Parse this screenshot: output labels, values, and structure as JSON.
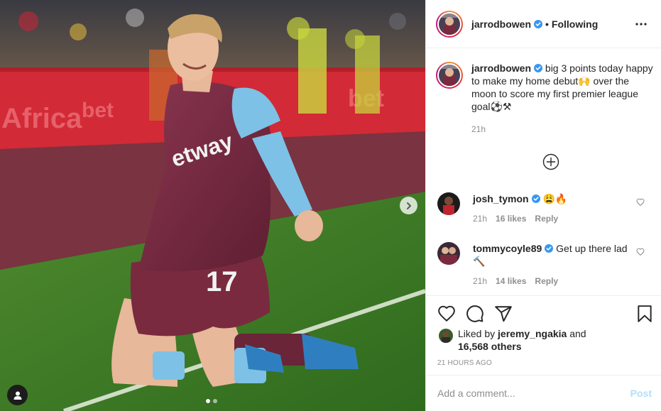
{
  "photo": {
    "jersey_number": "17",
    "sponsor_text": "Betway",
    "slide_count": 2,
    "active_slide": 1
  },
  "header": {
    "username": "jarrodbowen",
    "separator": "•",
    "follow_status": "Following",
    "more_icon": "ellipsis-icon"
  },
  "caption": {
    "username": "jarrodbowen",
    "text": "big 3 points today happy to make my home debut🙌 over the moon to score my first premier league goal⚽️⚒",
    "time": "21h"
  },
  "comments": [
    {
      "username": "josh_tymon",
      "text": "😩🔥",
      "time": "21h",
      "likes": "16 likes",
      "reply": "Reply"
    },
    {
      "username": "tommycoyle89",
      "text": "Get up there lad 🔨",
      "time": "21h",
      "likes": "14 likes",
      "reply": "Reply"
    }
  ],
  "actions": {
    "liked_by_prefix": "Liked by",
    "liked_by_user": "jeremy_ngakia",
    "liked_by_and": "and",
    "others": "16,568 others",
    "post_time": "21 HOURS AGO"
  },
  "add_comment": {
    "placeholder": "Add a comment...",
    "post_label": "Post"
  },
  "colors": {
    "verified": "#3897f0",
    "post_disabled": "#b2dffc",
    "claret": "#7a2a3f",
    "sky_blue": "#7ec1e6"
  }
}
